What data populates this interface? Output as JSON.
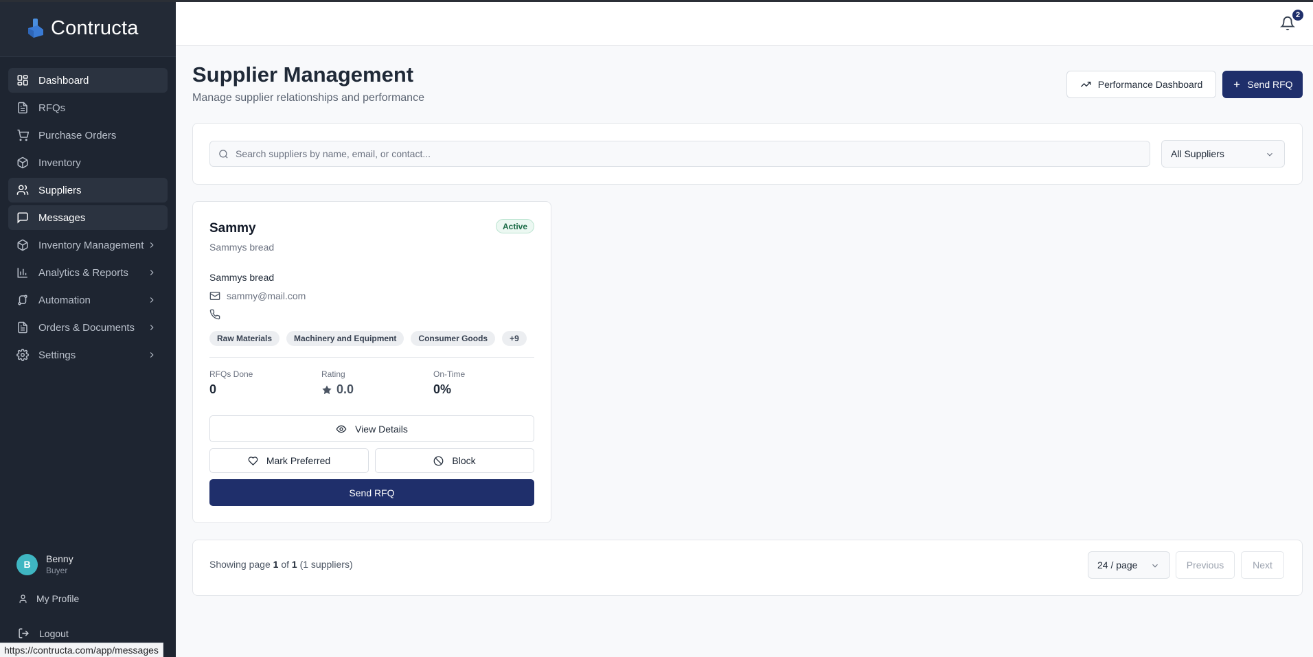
{
  "app": {
    "name": "Contructa"
  },
  "sidebar": {
    "items": [
      {
        "label": "Dashboard",
        "icon": "dashboard-icon",
        "active": true
      },
      {
        "label": "RFQs",
        "icon": "document-icon"
      },
      {
        "label": "Purchase Orders",
        "icon": "cart-icon"
      },
      {
        "label": "Inventory",
        "icon": "box-icon"
      },
      {
        "label": "Suppliers",
        "icon": "users-icon",
        "active": true
      },
      {
        "label": "Messages",
        "icon": "message-icon",
        "active": true
      },
      {
        "label": "Inventory Management",
        "icon": "box-icon",
        "expandable": true
      },
      {
        "label": "Analytics & Reports",
        "icon": "bar-chart-icon",
        "expandable": true
      },
      {
        "label": "Automation",
        "icon": "workflow-icon",
        "expandable": true
      },
      {
        "label": "Orders & Documents",
        "icon": "document-icon",
        "expandable": true
      },
      {
        "label": "Settings",
        "icon": "gear-icon",
        "expandable": true
      }
    ],
    "user": {
      "initial": "B",
      "name": "Benny",
      "role": "Buyer"
    },
    "my_profile": "My Profile",
    "logout": "Logout"
  },
  "topbar": {
    "notification_count": "2"
  },
  "header": {
    "title": "Supplier Management",
    "subtitle": "Manage supplier relationships and performance",
    "performance_button": "Performance Dashboard",
    "send_rfq_button": "Send RFQ"
  },
  "filters": {
    "search_placeholder": "Search suppliers by name, email, or contact...",
    "status_select": "All Suppliers"
  },
  "supplier": {
    "name": "Sammy",
    "company": "Sammys bread",
    "status": "Active",
    "contact_name": "Sammys bread",
    "email": "sammy@mail.com",
    "phone": "",
    "categories": [
      "Raw Materials",
      "Machinery and Equipment",
      "Consumer Goods",
      "+9"
    ],
    "stats": {
      "rfqs_label": "RFQs Done",
      "rfqs_value": "0",
      "rating_label": "Rating",
      "rating_value": "0.0",
      "ontime_label": "On-Time",
      "ontime_value": "0%"
    },
    "view_details": "View Details",
    "mark_preferred": "Mark Preferred",
    "block": "Block",
    "send_rfq": "Send RFQ"
  },
  "pagination": {
    "prefix": "Showing page ",
    "current": "1",
    "of": " of ",
    "total": "1",
    "suffix": " (1 suppliers)",
    "per_page": "24 / page",
    "previous": "Previous",
    "next": "Next"
  },
  "statusbar": {
    "url": "https://contructa.com/app/messages"
  },
  "colors": {
    "primary": "#1f2f6b",
    "sidebar_bg": "#1e2531",
    "avatar": "#3fb6c2",
    "active_badge": "#1c6b47"
  }
}
